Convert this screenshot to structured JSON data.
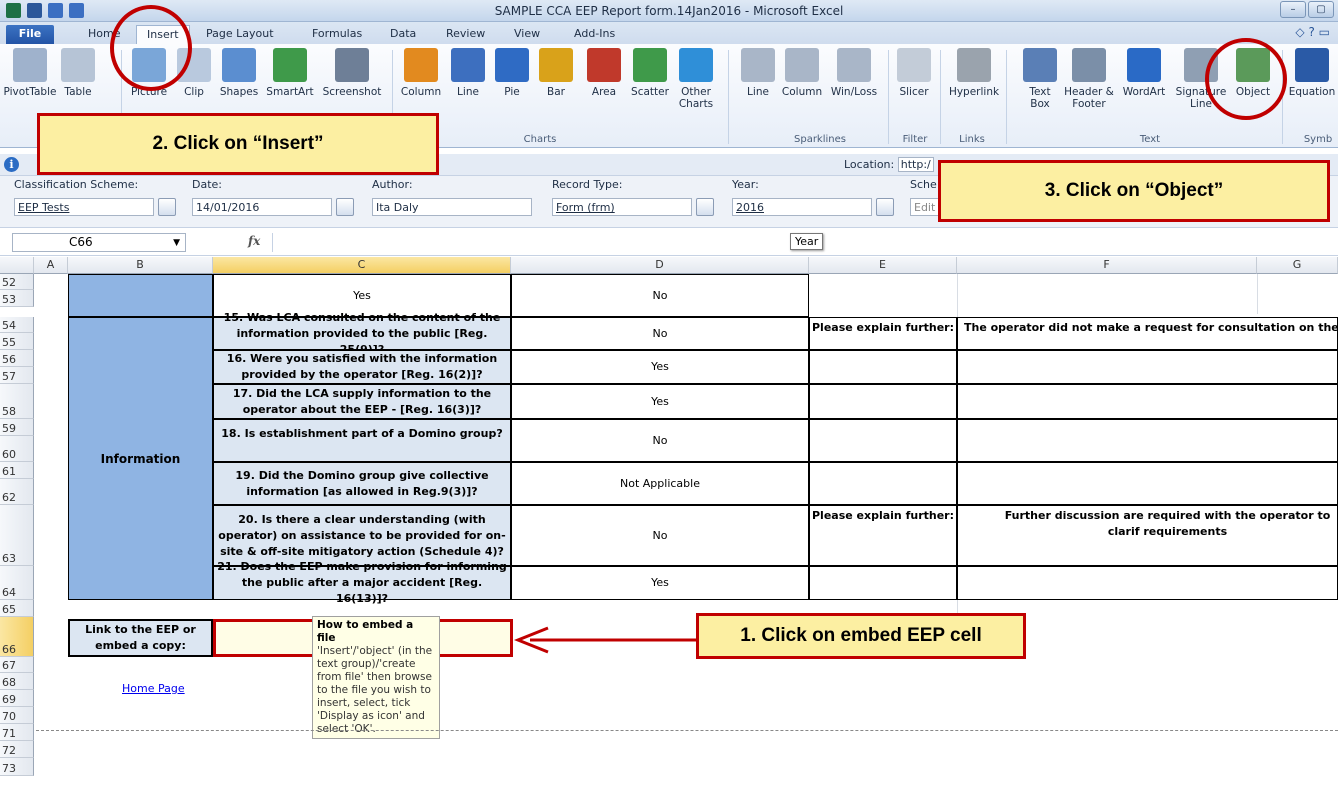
{
  "window": {
    "title": "SAMPLE CCA EEP Report form.14Jan2016  -  Microsoft Excel",
    "controls": [
      "–",
      "▢"
    ]
  },
  "tabs": [
    "File",
    "Home",
    "Insert",
    "Page Layout",
    "Formulas",
    "Data",
    "Review",
    "View",
    "Add-Ins"
  ],
  "ribbon": {
    "buttons": [
      {
        "label": "PivotTable",
        "color": "#9fb2cc"
      },
      {
        "label": "Table",
        "color": "#b6c4d6"
      },
      {
        "label": "Picture",
        "color": "#7aa6d8"
      },
      {
        "label": "Clip",
        "color": "#b9c9de"
      },
      {
        "label": "Shapes",
        "color": "#5b8ed0"
      },
      {
        "label": "SmartArt",
        "color": "#3f9a4a"
      },
      {
        "label": "Screenshot",
        "color": "#6e7f97"
      },
      {
        "label": "Column",
        "color": "#e28a1f"
      },
      {
        "label": "Line",
        "color": "#3d6fbf"
      },
      {
        "label": "Pie",
        "color": "#2f6bc4"
      },
      {
        "label": "Bar",
        "color": "#d9a21a"
      },
      {
        "label": "Area",
        "color": "#c0392b"
      },
      {
        "label": "Scatter",
        "color": "#3f9a4a"
      },
      {
        "label": "Other Charts",
        "color": "#2f8fd8"
      },
      {
        "label": "Line",
        "color": "#a9b6c8"
      },
      {
        "label": "Column",
        "color": "#a9b6c8"
      },
      {
        "label": "Win/Loss",
        "color": "#a9b6c8"
      },
      {
        "label": "Slicer",
        "color": "#c3ccd8"
      },
      {
        "label": "Hyperlink",
        "color": "#9aa3ad"
      },
      {
        "label": "Text Box",
        "color": "#5a7fb6"
      },
      {
        "label": "Header & Footer",
        "color": "#7b8fa8"
      },
      {
        "label": "WordArt",
        "color": "#2a6ac6"
      },
      {
        "label": "Signature Line",
        "color": "#8f9fb3"
      },
      {
        "label": "Object",
        "color": "#5b9a5a"
      },
      {
        "label": "Equation",
        "color": "#2a5aa6"
      }
    ],
    "groups": [
      "Charts",
      "Sparklines",
      "Filter",
      "Links",
      "Text",
      "Symb"
    ]
  },
  "info_bar": {
    "location_label": "Location:",
    "location_value": "http:/"
  },
  "meta": {
    "classification_label": "Classification Scheme:",
    "classification_value": "EEP Tests",
    "date_label": "Date:",
    "date_value": "14/01/2016",
    "author_label": "Author:",
    "author_value": "Ita Daly",
    "record_label": "Record Type:",
    "record_value": "Form (frm)",
    "year_label": "Year:",
    "year_value": "2016",
    "sche_label": "Sche",
    "edit_label": "Edit"
  },
  "formula_bar": {
    "name_box": "C66",
    "fx": "fx",
    "tooltip": "Year"
  },
  "columns": [
    "A",
    "B",
    "C",
    "D",
    "E",
    "F",
    "G"
  ],
  "rows": [
    "52",
    "53",
    "54",
    "55",
    "56",
    "57",
    "58",
    "59",
    "60",
    "61",
    "62",
    "63",
    "64",
    "65",
    "66",
    "67",
    "68",
    "69",
    "70",
    "71",
    "72",
    "73"
  ],
  "sheet": {
    "row52_c": "Yes",
    "row52_d": "No",
    "section_label": "Information",
    "questions": [
      {
        "q": "15. Was LCA consulted on the content of the information provided to the public [Reg. 25(9)]?",
        "a": "No",
        "e": "Please explain further:",
        "f": "The operator did not make a request for consultation on the inf"
      },
      {
        "q": "16. Were you satisfied with the  information provided by the operator [Reg. 16(2)]?",
        "a": "Yes",
        "e": "",
        "f": ""
      },
      {
        "q": "17. Did the LCA supply information to the operator about the EEP - [Reg. 16(3)]?",
        "a": "Yes",
        "e": "",
        "f": ""
      },
      {
        "q": "18. Is establishment part of a Domino group?",
        "a": "No",
        "e": "",
        "f": ""
      },
      {
        "q": "19. Did the Domino group give collective information [as allowed in Reg.9(3)]?",
        "a": "Not Applicable",
        "e": "",
        "f": ""
      },
      {
        "q": "20. Is there a clear understanding (with operator) on assistance to be provided for on-site & off-site mitigatory action (Schedule 4)?",
        "a": "No",
        "e": "Please explain further:",
        "f": "Further discussion are required with the operator to clarif requirements"
      },
      {
        "q": "21. Does the EEP make provision for informing the public after a major accident [Reg. 16(13)]?",
        "a": "Yes",
        "e": "",
        "f": ""
      }
    ],
    "link_label": "Link to the EEP or embed a copy:",
    "home_link": "Home Page",
    "tip_title": "How to embed a file",
    "tip_body": "'Insert'/'object' (in the text group)/'create from file' then browse to the file you wish to insert, select, tick 'Display as icon' and select 'OK'."
  },
  "callouts": {
    "step1": "1.   Click on embed EEP cell",
    "step2": "2.   Click on “Insert”",
    "step3": "3.   Click on “Object”"
  },
  "colors": {
    "accent_red": "#c00000",
    "callout_fill": "#fcefa2",
    "section_blue": "#8fb4e3",
    "question_fill": "#dce6f2"
  }
}
